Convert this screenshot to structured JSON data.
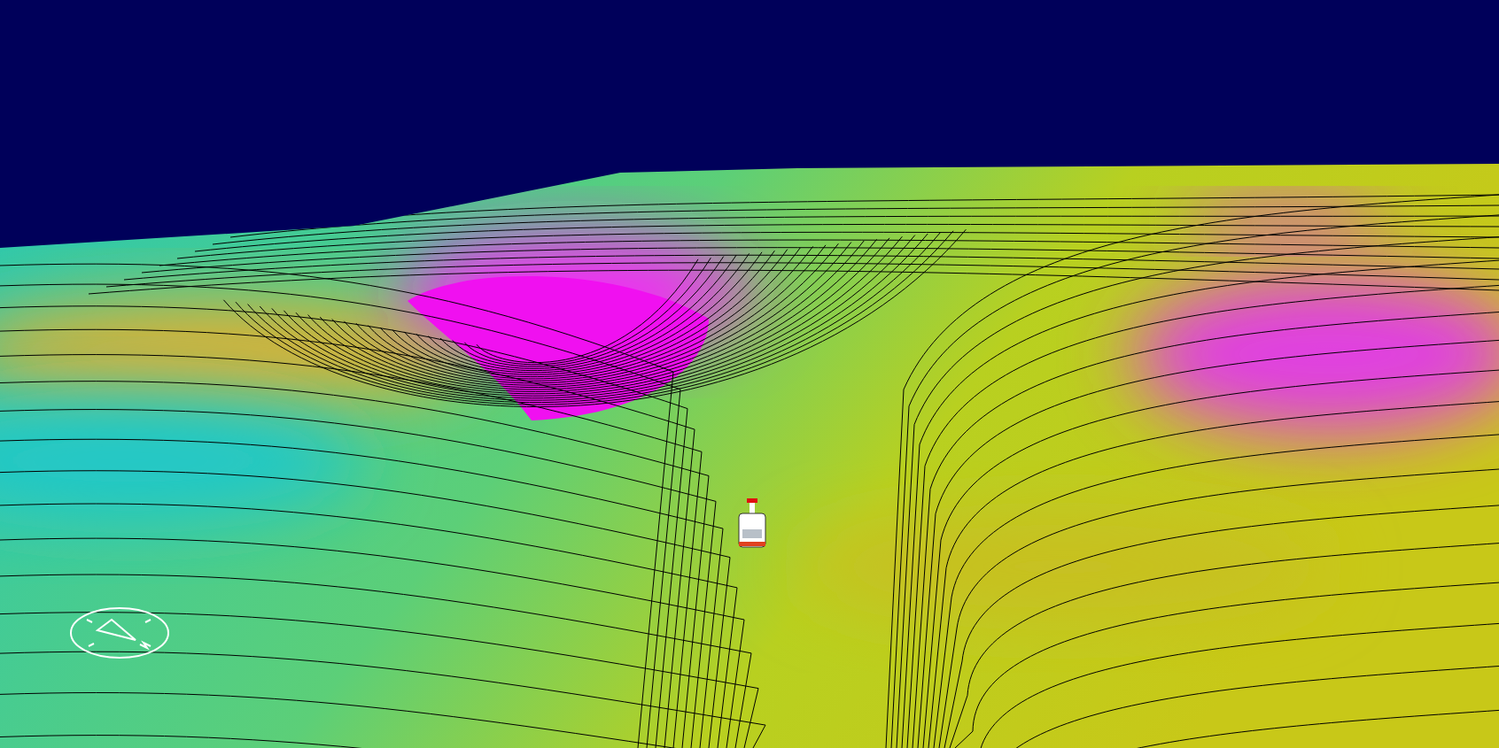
{
  "viewport": {
    "contour_lines": true,
    "show_compass": true,
    "show_vehicle": true
  }
}
